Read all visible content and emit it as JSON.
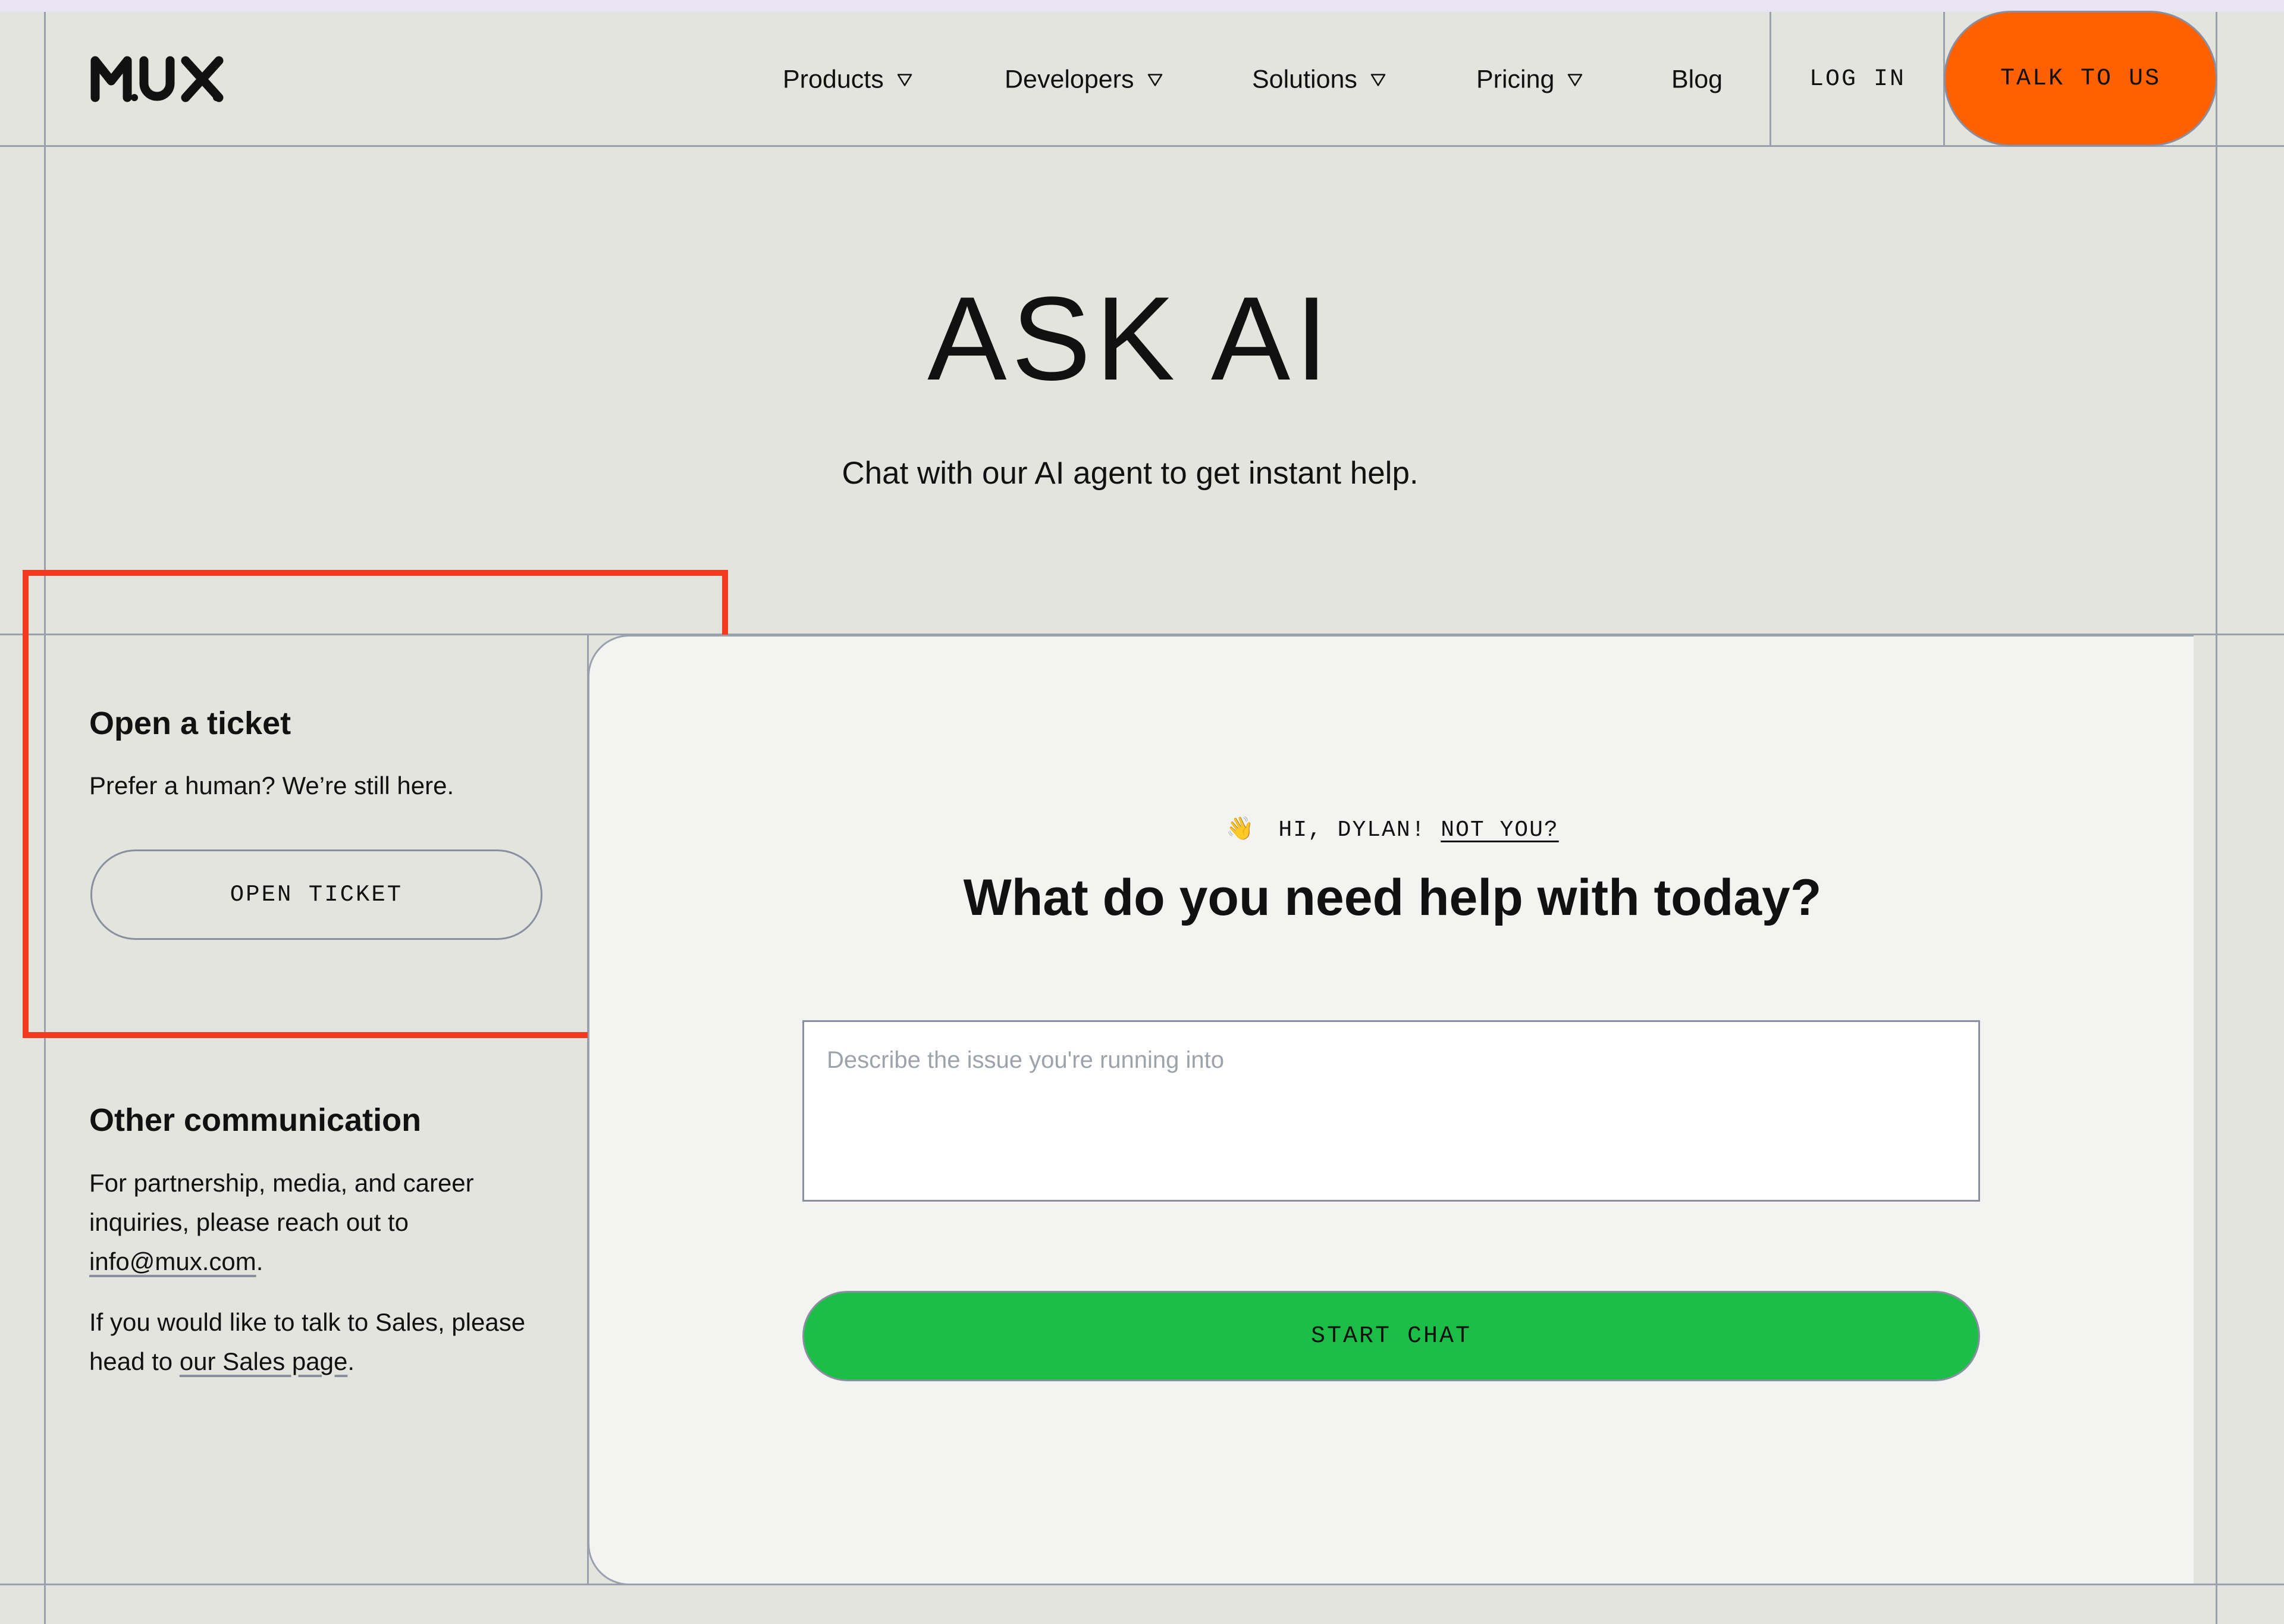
{
  "header": {
    "logo_text": "MUX",
    "nav": [
      {
        "label": "Products",
        "has_dropdown": true
      },
      {
        "label": "Developers",
        "has_dropdown": true
      },
      {
        "label": "Solutions",
        "has_dropdown": true
      },
      {
        "label": "Pricing",
        "has_dropdown": true
      },
      {
        "label": "Blog",
        "has_dropdown": false
      }
    ],
    "login_label": "LOG IN",
    "talk_label": "TALK TO US"
  },
  "hero": {
    "title": "ASK AI",
    "subtitle": "Chat with our AI agent to get instant help."
  },
  "ticket": {
    "heading": "Open a ticket",
    "text": "Prefer a human? We’re still here.",
    "button_label": "OPEN TICKET"
  },
  "other": {
    "heading": "Other communication",
    "text1_before": "For partnership, media, and career inquiries, please reach out to ",
    "email": "info@mux.com",
    "text1_after": ".",
    "text2_before": "If you would like to talk to Sales, please head to ",
    "sales_link": "our Sales page",
    "text2_after": "."
  },
  "chat": {
    "wave_emoji": "👋",
    "greeting": "HI, DYLAN!",
    "not_you": "NOT YOU?",
    "title": "What do you need help with today?",
    "input_placeholder": "Describe the issue you're running into",
    "input_value": "",
    "start_label": "START CHAT"
  },
  "colors": {
    "background": "#e4e4df",
    "card": "#f3f4f1",
    "accent_orange": "#ff6100",
    "accent_green": "#1bbf47",
    "highlight_red": "#f23a1d"
  }
}
